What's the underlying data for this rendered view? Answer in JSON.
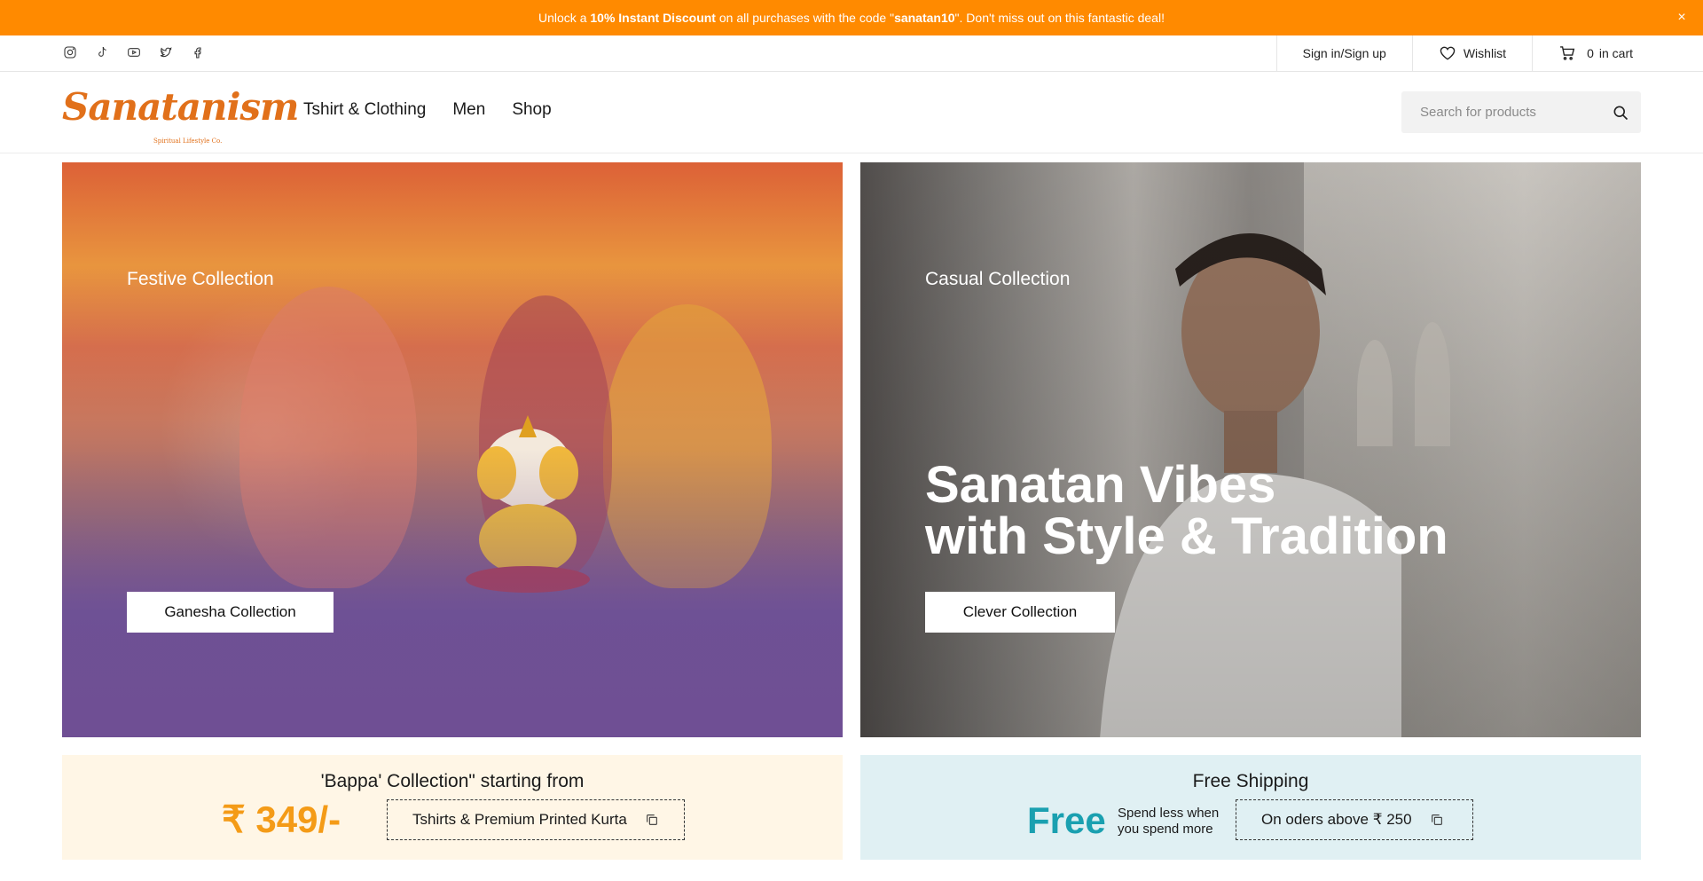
{
  "announcement": {
    "prefix": "Unlock a ",
    "bold1": "10% Instant Discount",
    "middle": " on all purchases with the code \"",
    "code": "sanatan10",
    "suffix": "\". Don't miss out on this fantastic deal!",
    "close": "×"
  },
  "utility": {
    "socials": [
      "instagram-icon",
      "tiktok-icon",
      "youtube-icon",
      "twitter-icon",
      "facebook-icon"
    ],
    "signin": "Sign in/Sign up",
    "wishlist": "Wishlist",
    "cart_count": "0",
    "cart_label": "in cart"
  },
  "header": {
    "logo_word": "Sanatanism",
    "logo_tag": "Spiritual Lifestyle Co.",
    "nav": [
      "Tshirt & Clothing",
      "Men",
      "Shop"
    ],
    "search_placeholder": "Search for products"
  },
  "banners": {
    "left": {
      "label": "Festive Collection",
      "button": "Ganesha Collection"
    },
    "right": {
      "label": "Casual Collection",
      "headline_line1": "Sanatan Vibes",
      "headline_line2": "with Style & Tradition",
      "button": "Clever Collection"
    }
  },
  "promos": {
    "left": {
      "title": "'Bappa' Collection\" starting from",
      "price": "₹ 349/-",
      "coupon": "Tshirts & Premium Printed Kurta"
    },
    "right": {
      "title": "Free Shipping",
      "big": "Free",
      "spend1": "Spend less when",
      "spend2": "you spend more",
      "coupon": "On oders above ₹ 250"
    }
  },
  "colors": {
    "accent": "#ff8a00",
    "logo": "#e1701a",
    "price": "#f49b17",
    "free": "#1aa0b0"
  }
}
